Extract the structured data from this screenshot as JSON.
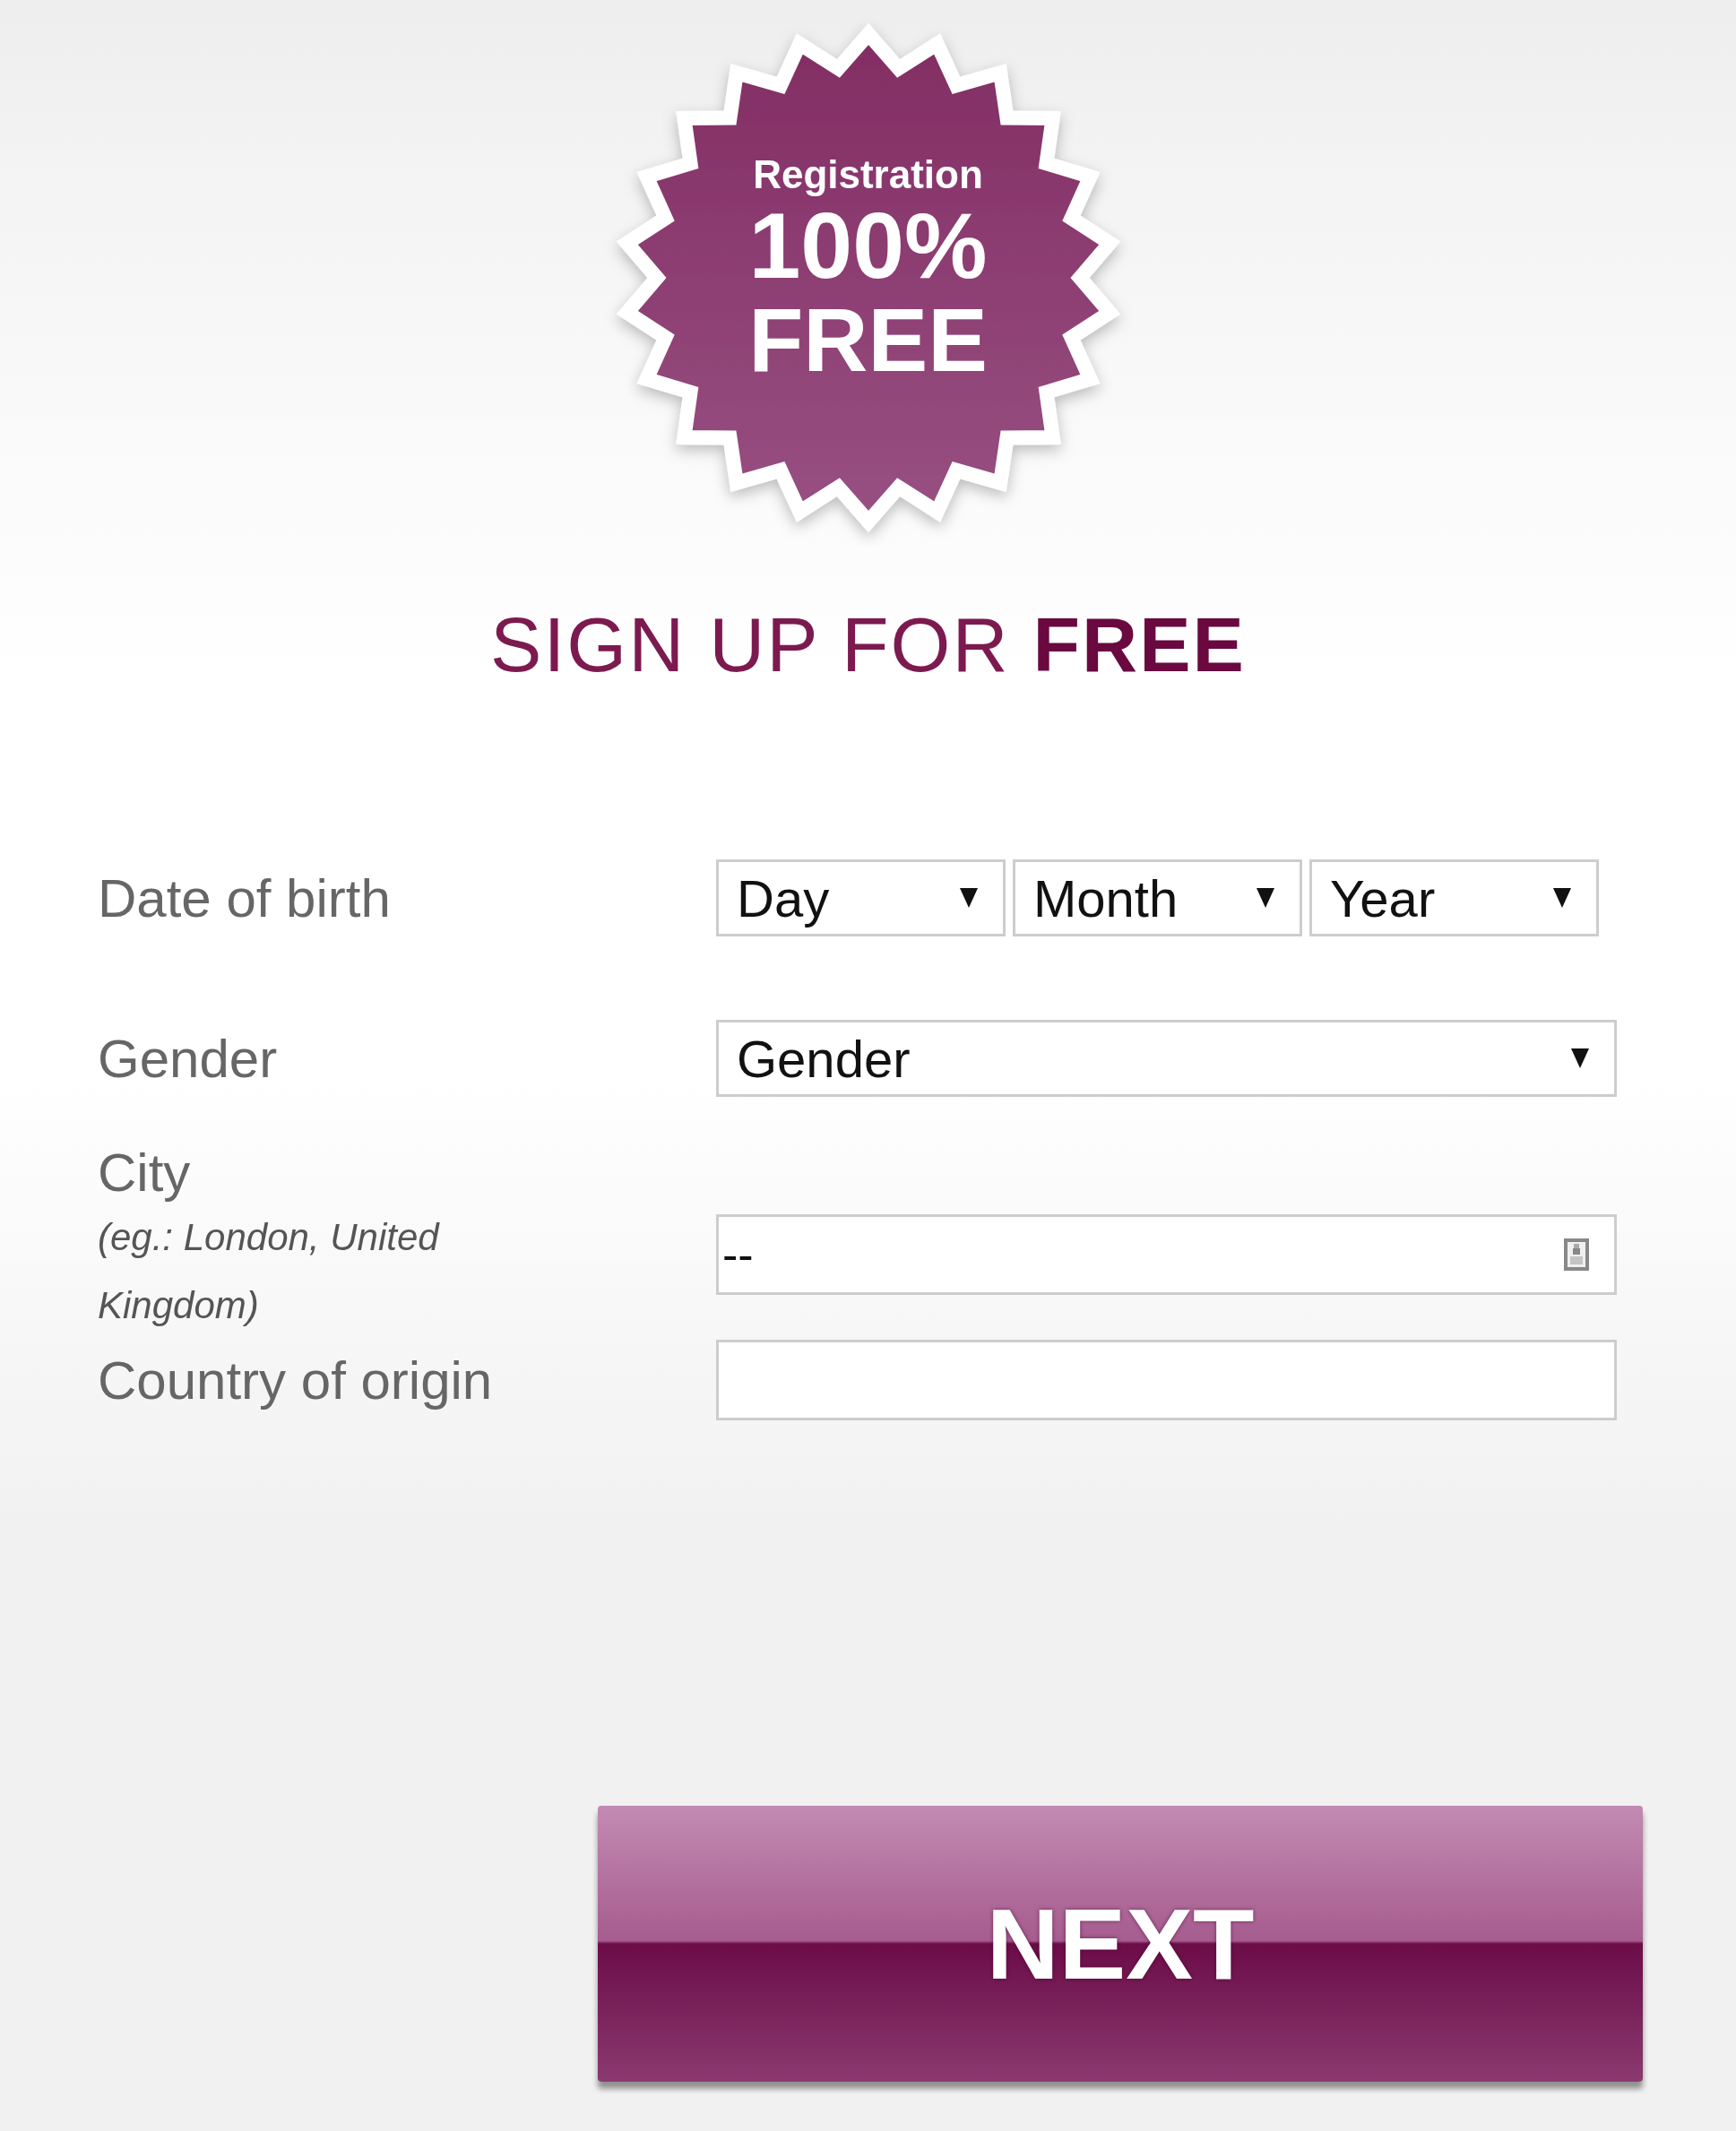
{
  "badge": {
    "line_1": "Registration",
    "line_2": "100%",
    "line_3": "FREE"
  },
  "heading": "SIGN UP FOR **FREE**",
  "fields": [
    {
      "kind": "date",
      "label": "Date of birth",
      "selects": [
        {
          "value": "Day"
        },
        {
          "value": "Month"
        },
        {
          "value": "Year"
        }
      ]
    },
    {
      "kind": "select",
      "label": "Gender",
      "value": "Gender"
    },
    {
      "kind": "text",
      "label": "City",
      "hint": "(eg.: London, United Kingdom)",
      "value": "--",
      "contact_icon": true
    },
    {
      "kind": "text",
      "label": "Country of origin"
    }
  ],
  "button": "NEXT"
}
